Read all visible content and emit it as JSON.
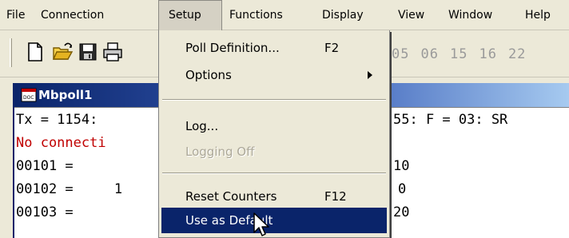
{
  "menubar": {
    "items": [
      "File",
      "Connection",
      "Setup",
      "Functions",
      "Display",
      "View",
      "Window",
      "Help"
    ],
    "active": "Setup"
  },
  "toolbar": {
    "icons": [
      "new-icon",
      "open-icon",
      "save-icon",
      "print-icon"
    ],
    "function_codes": [
      "05",
      "06",
      "15",
      "16",
      "22"
    ]
  },
  "window": {
    "title": "Mbpoll1",
    "lines": [
      {
        "left": "Tx = 1154:",
        "right": "55: F = 03: SR"
      },
      {
        "left": "No connecti",
        "right": ""
      },
      {
        "left": "00101 =",
        "right": "10"
      },
      {
        "left": "00102 =     1",
        "right": "0"
      },
      {
        "left": "00103 =",
        "right": "20"
      }
    ]
  },
  "setup_menu": {
    "items": [
      {
        "label": "Poll Definition...",
        "shortcut": "F2"
      },
      {
        "label": "Options",
        "submenu": true
      },
      {
        "label": "Log..."
      },
      {
        "label": "Logging Off",
        "disabled": true
      },
      {
        "label": "Reset Counters",
        "shortcut": "F12"
      },
      {
        "label": "Use as Default",
        "highlighted": true
      }
    ]
  },
  "colors": {
    "highlight": "#0a246a",
    "title_gradient_start": "#0a246a",
    "title_gradient_end": "#a6caf0",
    "error_text": "#c00000",
    "disabled_text": "#aca899"
  }
}
